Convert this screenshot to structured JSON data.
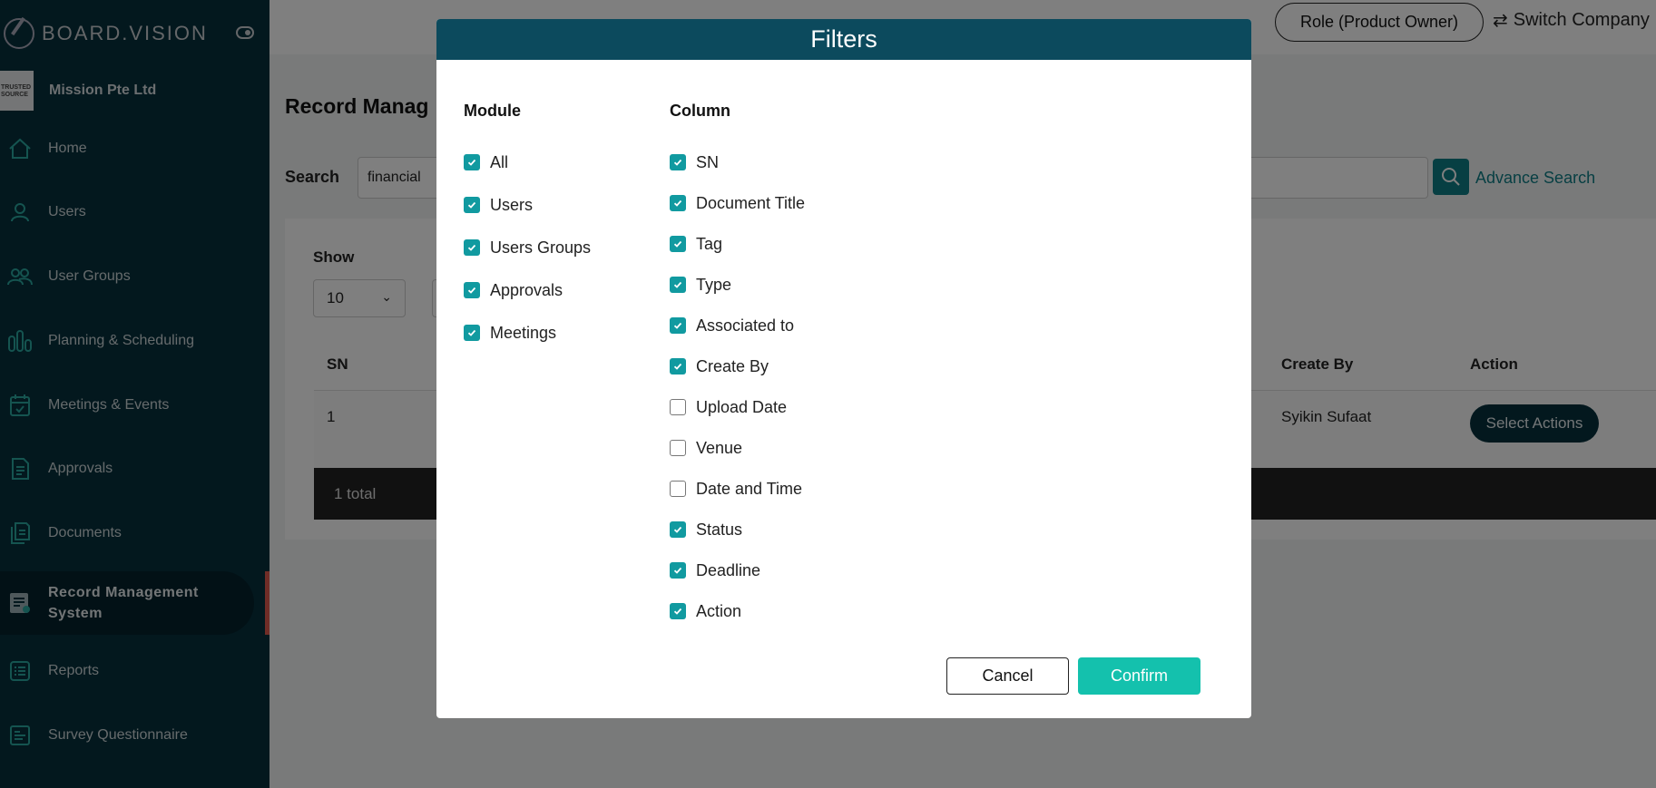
{
  "app": {
    "logo_text": "BOARD.VISION"
  },
  "company": {
    "logo_text": "TRUSTED SOURCE",
    "name": "Mission Pte Ltd"
  },
  "sidebar": {
    "items": [
      {
        "label": "Home",
        "icon": "home-icon"
      },
      {
        "label": "Users",
        "icon": "user-icon"
      },
      {
        "label": "User Groups",
        "icon": "users-icon"
      },
      {
        "label": "Planning & Scheduling",
        "icon": "bar-chart-icon"
      },
      {
        "label": "Meetings & Events",
        "icon": "calendar-icon"
      },
      {
        "label": "Approvals",
        "icon": "approval-doc-icon"
      },
      {
        "label": "Documents",
        "icon": "documents-icon"
      },
      {
        "label": "Record Management System",
        "icon": "record-icon",
        "active": true
      },
      {
        "label": "Reports",
        "icon": "reports-icon"
      },
      {
        "label": "Survey Questionnaire",
        "icon": "survey-icon"
      }
    ]
  },
  "header": {
    "role_label": "Role (Product Owner)",
    "switch_label": "Switch Company"
  },
  "page": {
    "title": "Record Manag",
    "search_label": "Search",
    "search_value": "financial",
    "advance_search": "Advance Search",
    "show_label": "Show",
    "show_value": "10",
    "table": {
      "headers": {
        "sn": "SN",
        "create_by": "Create By",
        "action": "Action"
      },
      "row": {
        "sn": "1",
        "create_by": "Syikin Sufaat",
        "action": "Select Actions"
      },
      "footer": "1 total"
    }
  },
  "modal": {
    "title": "Filters",
    "module_title": "Module",
    "column_title": "Column",
    "modules": [
      {
        "label": "All",
        "checked": true
      },
      {
        "label": "Users",
        "checked": true
      },
      {
        "label": "Users Groups",
        "checked": true
      },
      {
        "label": "Approvals",
        "checked": true
      },
      {
        "label": "Meetings",
        "checked": true
      }
    ],
    "columns": [
      {
        "label": "SN",
        "checked": true
      },
      {
        "label": "Document Title",
        "checked": true
      },
      {
        "label": "Tag",
        "checked": true
      },
      {
        "label": "Type",
        "checked": true
      },
      {
        "label": "Associated to",
        "checked": true
      },
      {
        "label": "Create By",
        "checked": true
      },
      {
        "label": "Upload Date",
        "checked": false
      },
      {
        "label": "Venue",
        "checked": false
      },
      {
        "label": "Date and Time",
        "checked": false
      },
      {
        "label": "Status",
        "checked": true
      },
      {
        "label": "Deadline",
        "checked": true
      },
      {
        "label": "Action",
        "checked": true
      }
    ],
    "cancel_label": "Cancel",
    "confirm_label": "Confirm"
  },
  "colors": {
    "sidebar_bg": "#06303d",
    "accent": "#119aa0",
    "confirm": "#14c1ad",
    "active_marker": "#e05a4e"
  }
}
